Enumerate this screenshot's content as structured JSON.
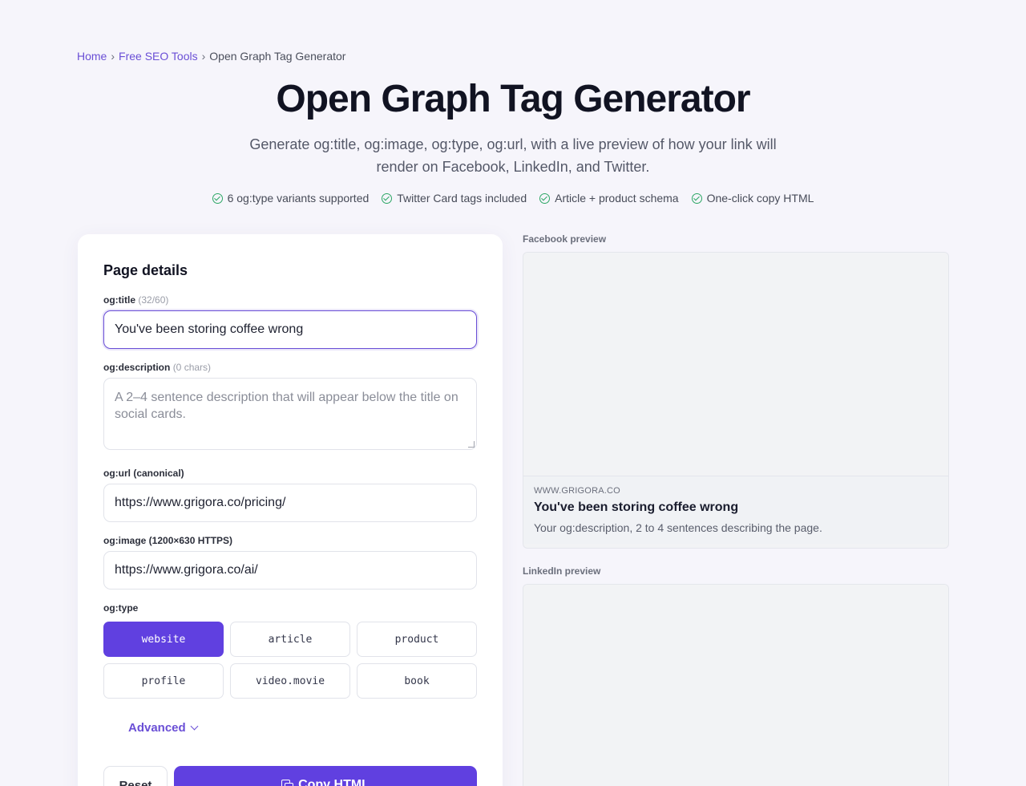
{
  "breadcrumb": {
    "home": "Home",
    "section": "Free SEO Tools",
    "current": "Open Graph Tag Generator",
    "separator": "›"
  },
  "header": {
    "title": "Open Graph Tag Generator",
    "subtitle": "Generate og:title, og:image, og:type, og:url, with a live preview of how your link will render on Facebook, LinkedIn, and Twitter."
  },
  "features": [
    "6 og:type variants supported",
    "Twitter Card tags included",
    "Article + product schema",
    "One-click copy HTML"
  ],
  "form": {
    "heading": "Page details",
    "title_label": "og:title",
    "title_hint": "(32/60)",
    "title_value": "You've been storing coffee wrong",
    "description_label": "og:description",
    "description_hint": "(0 chars)",
    "description_placeholder": "A 2–4 sentence description that will appear below the title on social cards.",
    "url_label": "og:url (canonical)",
    "url_value": "https://www.grigora.co/pricing/",
    "image_label": "og:image (1200×630 HTTPS)",
    "image_value": "https://www.grigora.co/ai/",
    "type_label": "og:type",
    "types": [
      "website",
      "article",
      "product",
      "profile",
      "video.movie",
      "book"
    ],
    "selected_type": "website",
    "advanced_label": "Advanced",
    "reset_label": "Reset",
    "copy_label": "Copy HTML"
  },
  "facebook_preview": {
    "label": "Facebook preview",
    "domain": "WWW.GRIGORA.CO",
    "title": "You've been storing coffee wrong",
    "description": "Your og:description, 2 to 4 sentences describing the page."
  },
  "linkedin_preview": {
    "label": "LinkedIn preview"
  },
  "colors": {
    "accent": "#6040e0",
    "link": "#6a4fd6",
    "check": "#2ca665",
    "background": "#f6f5fb"
  },
  "icons": {
    "feature": "check-circle-icon",
    "advanced": "chevron-down-icon",
    "copy": "copy-icon"
  }
}
